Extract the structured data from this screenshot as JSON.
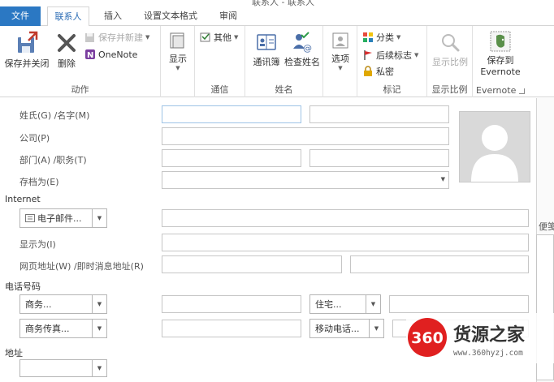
{
  "window": {
    "title": "联系人 - 联系人"
  },
  "tabs": [
    {
      "label": "文件"
    },
    {
      "label": "联系人"
    },
    {
      "label": "插入"
    },
    {
      "label": "设置文本格式"
    },
    {
      "label": "审阅"
    }
  ],
  "ribbon": {
    "actions": {
      "label": "动作",
      "save_close": "保存并关闭",
      "delete": "删除",
      "save_new": "保存并新建",
      "onenote": "OneNote"
    },
    "show": {
      "label": "显示"
    },
    "comm": {
      "label": "通信",
      "other": "其他"
    },
    "names": {
      "label": "姓名",
      "address_book": "通讯簿",
      "check_names": "检查姓名"
    },
    "options": {
      "label": "选项"
    },
    "tags": {
      "label": "标记",
      "categorize": "分类",
      "follow_up": "后续标志",
      "private": "私密"
    },
    "zoom": {
      "label": "显示比例",
      "btn": "显示比例"
    },
    "evernote": {
      "label": "Evernote",
      "save_line1": "保存到",
      "save_line2": "Evernote"
    }
  },
  "form": {
    "name_label": "姓氏(G) /名字(M)",
    "company_label": "公司(P)",
    "dept_label": "部门(A) /职务(T)",
    "fileas_label": "存档为(E)",
    "internet_section": "Internet",
    "email_button": "电子邮件...",
    "display_label": "显示为(I)",
    "web_label": "网页地址(W) /即时消息地址(R)",
    "phone_section": "电话号码",
    "phone_business": "商务...",
    "phone_home": "住宅...",
    "phone_biz_fax": "商务传真...",
    "phone_mobile": "移动电话...",
    "address_section": "地址",
    "notes_label": "便笺"
  },
  "watermark": {
    "brand": "360",
    "text": "货源之家",
    "url": "www.360hyzj.com"
  },
  "colors": {
    "accent": "#2b78c3",
    "tab_active_text": "#2b6cb5",
    "watermark_red": "#e02020"
  }
}
